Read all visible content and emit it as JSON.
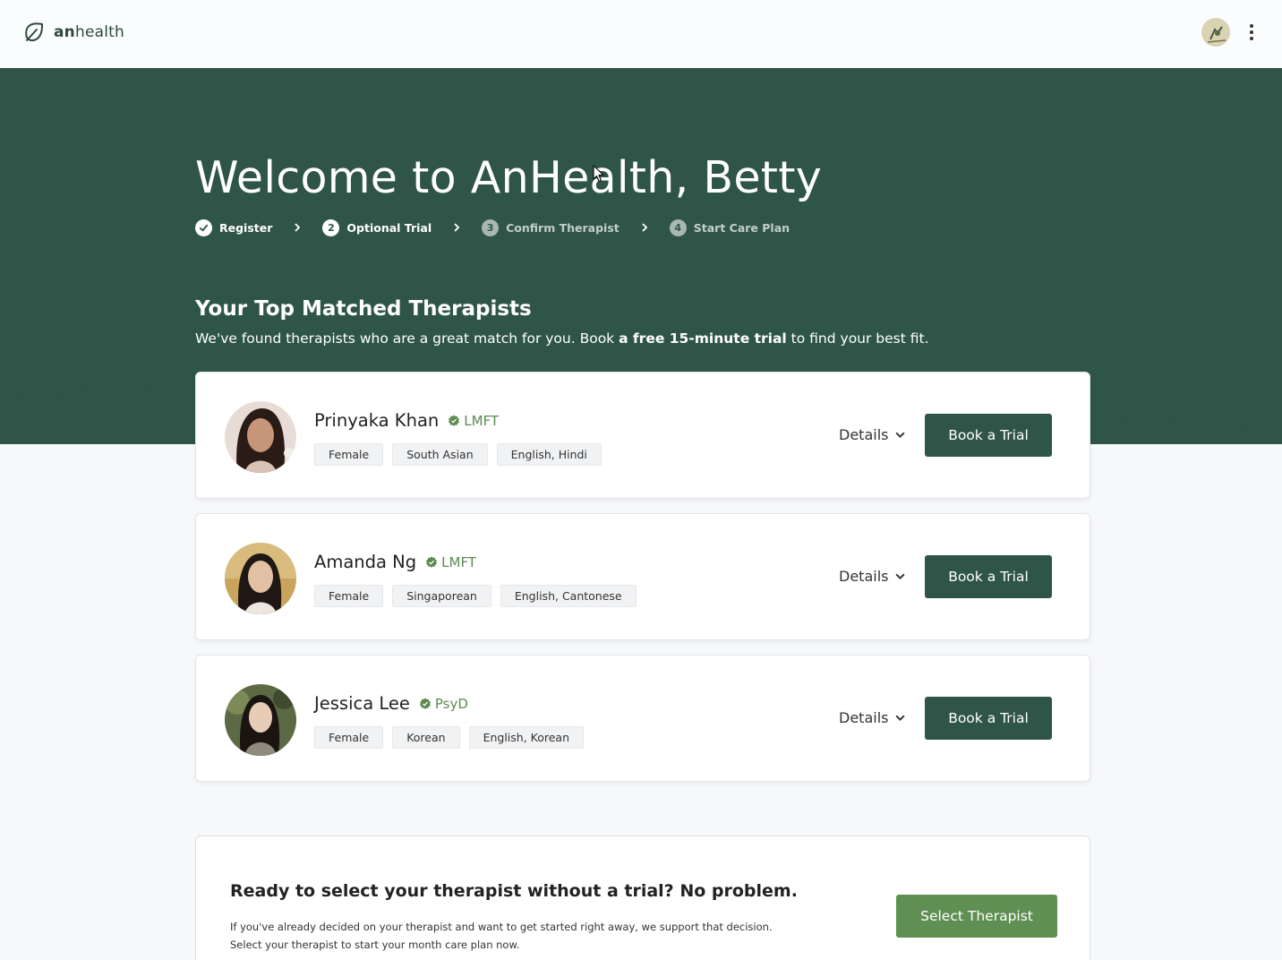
{
  "header": {
    "logo_bold": "an",
    "logo_rest": "health",
    "menu_icon": "kebab-icon"
  },
  "hero": {
    "welcome": "Welcome to AnHealth, Betty",
    "steps": [
      {
        "num": "",
        "label": "Register",
        "state": "done"
      },
      {
        "num": "2",
        "label": "Optional Trial",
        "state": "active"
      },
      {
        "num": "3",
        "label": "Confirm Therapist",
        "state": "pending"
      },
      {
        "num": "4",
        "label": "Start Care Plan",
        "state": "pending"
      }
    ],
    "section_title": "Your Top Matched Therapists",
    "section_sub_before": "We've found therapists who are a great match for you. Book ",
    "section_sub_bold": "a free 15-minute trial",
    "section_sub_after": " to find your best fit."
  },
  "therapists": [
    {
      "name": "Prinyaka Khan",
      "credential": "LMFT",
      "tags": [
        "Female",
        "South Asian",
        "English, Hindi"
      ],
      "details_label": "Details",
      "book_label": "Book a Trial"
    },
    {
      "name": "Amanda Ng",
      "credential": "LMFT",
      "tags": [
        "Female",
        "Singaporean",
        "English, Cantonese"
      ],
      "details_label": "Details",
      "book_label": "Book a Trial"
    },
    {
      "name": "Jessica Lee",
      "credential": "PsyD",
      "tags": [
        "Female",
        "Korean",
        "English, Korean"
      ],
      "details_label": "Details",
      "book_label": "Book a Trial"
    }
  ],
  "ready": {
    "title": "Ready to select your therapist without a trial? No problem.",
    "line1": "If you've already decided on your therapist and want to get started right away, we support that decision.",
    "line2": "Select your therapist to start your month care plan now.",
    "button": "Select Therapist"
  },
  "colors": {
    "brand_dark": "#2f5548",
    "brand_green": "#5f8f52",
    "credential_green": "#5c8a4f"
  }
}
